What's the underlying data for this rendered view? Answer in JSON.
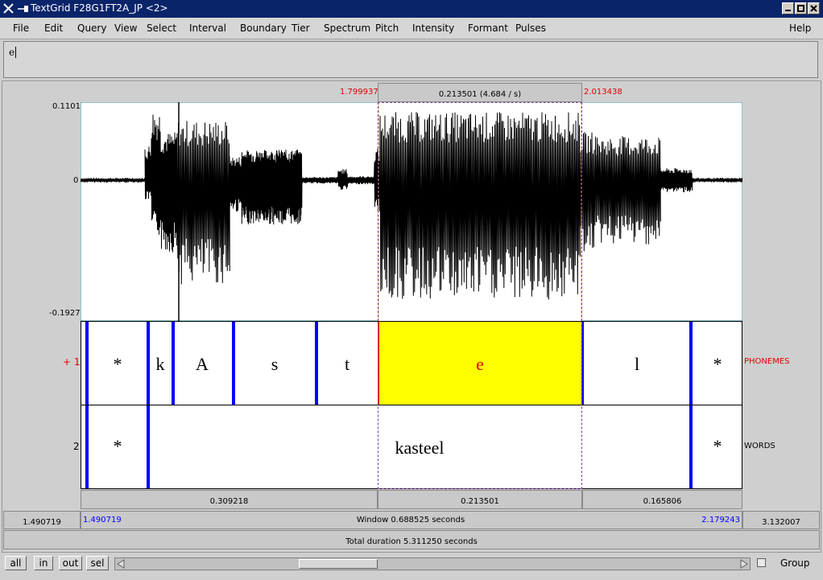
{
  "window": {
    "title": "TextGrid F28G1FT2A_JP <2>",
    "controls": [
      "_",
      "□",
      "×"
    ]
  },
  "menu": [
    "File",
    "Edit",
    "Query",
    "View",
    "Select",
    "Interval",
    "Boundary",
    "Tier",
    "Spectrum",
    "Pitch",
    "Intensity",
    "Formant",
    "Pulses",
    "Help"
  ],
  "text_field": {
    "value": "e"
  },
  "selection": {
    "start": "1.799937",
    "end": "2.013438",
    "duration_label": "0.213501 (4.684 / s)"
  },
  "waveform": {
    "ymax": "0.1101",
    "zero": "0",
    "ymin": "-0.1927"
  },
  "tiers": [
    {
      "number": "1",
      "marker": "+",
      "name": "PHONEMES",
      "intervals": [
        "*",
        "k",
        "A",
        "s",
        "t",
        "e",
        "l",
        "*"
      ],
      "selected_interval": "e"
    },
    {
      "number": "2",
      "name": "WORDS",
      "intervals": [
        "*",
        "",
        "kasteel",
        "*"
      ]
    }
  ],
  "segment_durations": [
    "0.309218",
    "0.213501",
    "0.165806"
  ],
  "window_bar": {
    "left_total": "1.490719",
    "visible_start": "1.490719",
    "window_label": "Window 0.688525 seconds",
    "visible_end": "2.179243",
    "right_total": "3.132007"
  },
  "total_duration": "Total duration 5.311250 seconds",
  "buttons": {
    "all": "all",
    "in": "in",
    "out": "out",
    "sel": "sel",
    "group": "Group"
  },
  "colors": {
    "title_bar": "#0a246a",
    "selection": "#ffff00",
    "boundary": "#0000ff",
    "cursor_text": "#e00000"
  }
}
